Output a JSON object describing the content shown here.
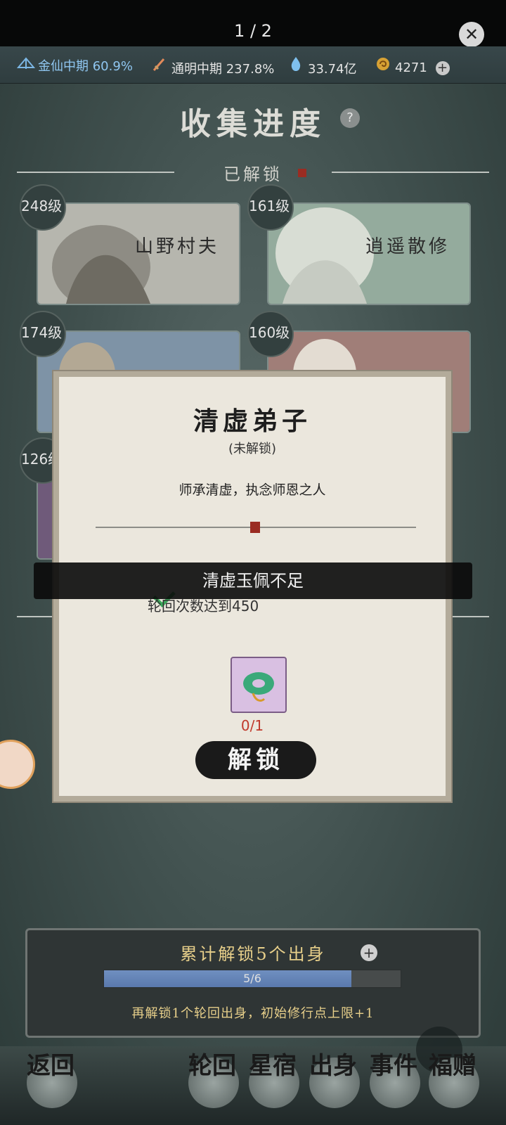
{
  "viewer": {
    "page_indicator": "1 / 2"
  },
  "status": {
    "realm_label": "金仙中期",
    "realm_pct": "60.9%",
    "weapon_label": "通明中期",
    "weapon_pct": "237.8%",
    "crystal": "33.74亿",
    "coins": "4271"
  },
  "header": {
    "title": "收集进度",
    "section": "已解锁"
  },
  "cards": [
    {
      "level": "248级",
      "name": "山野村夫"
    },
    {
      "level": "161级",
      "name": "逍遥散修"
    },
    {
      "level": "174级",
      "name": ""
    },
    {
      "level": "160级",
      "name": ""
    },
    {
      "level": "126级",
      "name": ""
    }
  ],
  "modal": {
    "title": "清虚弟子",
    "status": "(未解锁)",
    "description": "师承清虚，执念师恩之人",
    "condition": "轮回次数达到450",
    "item_count": "0/1",
    "unlock_label": "解锁"
  },
  "toast": {
    "message": "清虚玉佩不足"
  },
  "progress": {
    "title": "累计解锁5个出身",
    "bar_text": "5/6",
    "fraction": 0.833,
    "subtitle": "再解锁1个轮回出身，初始修行点上限+1"
  },
  "nav": [
    {
      "id": "back",
      "label": "返回"
    },
    {
      "id": "reincarnation",
      "label": "轮回"
    },
    {
      "id": "star",
      "label": "星宿"
    },
    {
      "id": "origin",
      "label": "出身"
    },
    {
      "id": "event",
      "label": "事件"
    },
    {
      "id": "gift",
      "label": "福赠"
    }
  ]
}
